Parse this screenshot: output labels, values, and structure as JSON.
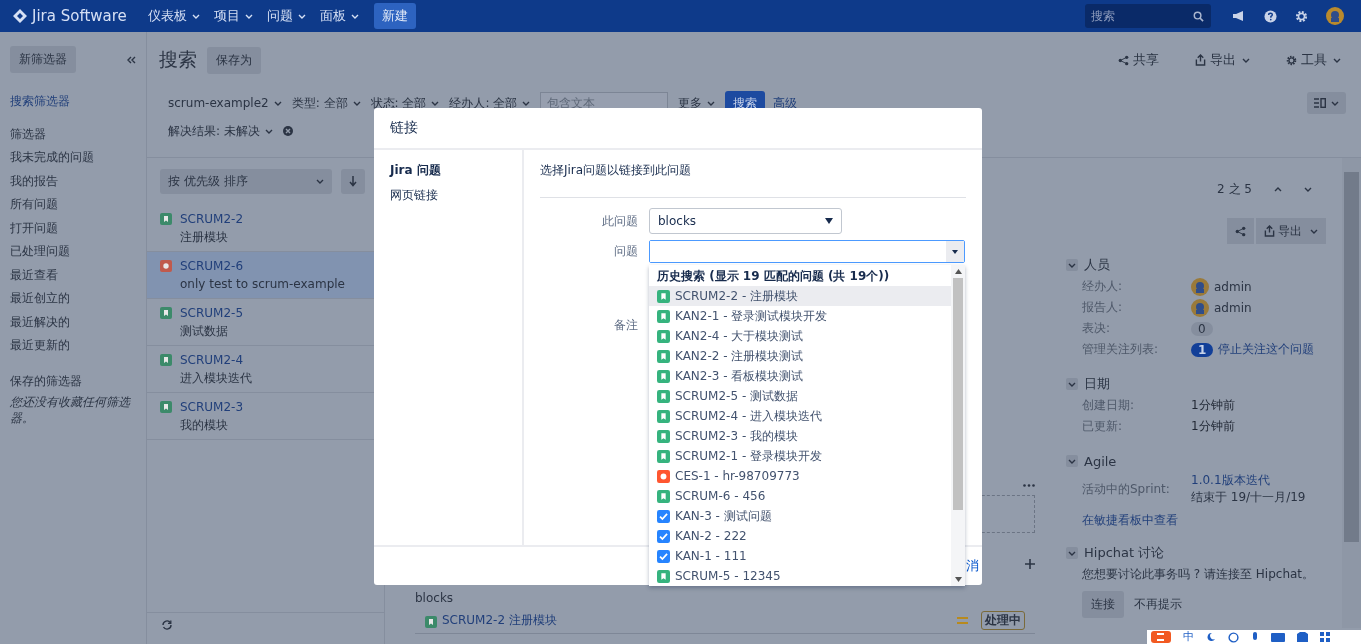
{
  "topbar": {
    "logo": "Jira Software",
    "menus": [
      {
        "label": "仪表板"
      },
      {
        "label": "项目"
      },
      {
        "label": "问题"
      },
      {
        "label": "面板"
      }
    ],
    "create_button": "新建",
    "search": {
      "placeholder": "搜索"
    }
  },
  "sidebar": {
    "new_filter_button": "新筛选器",
    "search_filters_link": "搜索筛选器",
    "filters_heading": "筛选器",
    "items": [
      "我未完成的问题",
      "我的报告",
      "所有问题",
      "打开问题",
      "已处理问题",
      "最近查看",
      "最近创立的",
      "最近解决的",
      "最近更新的"
    ],
    "saved_heading": "保存的筛选器",
    "saved_note": "您还没有收藏任何筛选器。"
  },
  "header": {
    "title": "搜索",
    "save_as_button": "保存为",
    "actions": [
      {
        "kind": "share",
        "label": "共享",
        "menu": false
      },
      {
        "kind": "export",
        "label": "导出",
        "menu": true
      },
      {
        "kind": "tools",
        "label": "工具",
        "menu": true
      }
    ]
  },
  "filters": {
    "items": [
      "scrum-example2",
      "类型: 全部",
      "状态: 全部",
      "经办人: 全部"
    ],
    "text_search": {
      "placeholder": "包含文本"
    },
    "more": "更多",
    "search_button": "搜索",
    "advanced_link": "高级",
    "resolution": "解决结果: 未解决"
  },
  "issue_list": {
    "sort": "按 优先级 排序",
    "items": [
      {
        "key": "SCRUM2-2",
        "summary": "注册模块",
        "kind": "story",
        "selected": false
      },
      {
        "key": "SCRUM2-6",
        "summary": "only test to scrum-example",
        "kind": "bug",
        "selected": true
      },
      {
        "key": "SCRUM2-5",
        "summary": "测试数据",
        "kind": "story",
        "selected": false
      },
      {
        "key": "SCRUM2-4",
        "summary": "进入模块迭代",
        "kind": "story",
        "selected": false
      },
      {
        "key": "SCRUM2-3",
        "summary": "我的模块",
        "kind": "story",
        "selected": false
      }
    ]
  },
  "detail": {
    "pager": "2 之 5",
    "export_button": "导出",
    "link_group": {
      "label": "blocks",
      "issue": "SCRUM2-2 注册模块",
      "kind": "story",
      "status": "处理中"
    },
    "sections": [
      {
        "title": "人员",
        "expanded": true,
        "rows": [
          {
            "kind": "user",
            "label": "经办人:",
            "value": "admin"
          },
          {
            "kind": "user",
            "label": "报告人:",
            "value": "admin"
          },
          {
            "kind": "count",
            "label": "表决:",
            "value": "0"
          },
          {
            "kind": "watch",
            "label": "管理关注列表:",
            "value": "1",
            "link": "停止关注这个问题"
          }
        ]
      },
      {
        "title": "日期",
        "expanded": true,
        "rows": [
          {
            "kind": "text",
            "label": "创建日期:",
            "value": "1分钟前"
          },
          {
            "kind": "text",
            "label": "已更新:",
            "value": "1分钟前"
          }
        ]
      },
      {
        "title": "Agile",
        "expanded": true,
        "rows": [
          {
            "kind": "sprint",
            "label": "活动中的Sprint:",
            "value": "1.0.1版本迭代",
            "note": "结束于 19/十一月/19"
          }
        ],
        "link": "在敏捷看板中查看"
      },
      {
        "title": "Hipchat 讨论",
        "expanded": true,
        "text": "您想要讨论此事务吗 ? 请连接至 Hipchat。",
        "buttons": [
          "连接",
          "不再提示"
        ]
      }
    ]
  },
  "modal": {
    "title": "链接",
    "nav": [
      {
        "label": "Jira 问题",
        "selected": true
      },
      {
        "label": "网页链接",
        "selected": false
      }
    ],
    "description": "选择Jira问题以链接到此问题",
    "link_type": {
      "label": "此问题",
      "value": "blocks"
    },
    "issue": {
      "label": "问题"
    },
    "comment": {
      "label": "备注"
    },
    "cancel": "消",
    "dropdown": {
      "heading": "历史搜索 (显示 19 匹配的问题 (共 19个))",
      "items": [
        {
          "text": "SCRUM2-2 - 注册模块",
          "kind": "story",
          "selected": true
        },
        {
          "text": "KAN2-1 - 登录测试模块开发",
          "kind": "story",
          "selected": false
        },
        {
          "text": "KAN2-4 - 大于模块测试",
          "kind": "story",
          "selected": false
        },
        {
          "text": "KAN2-2 - 注册模块测试",
          "kind": "story",
          "selected": false
        },
        {
          "text": "KAN2-3 - 看板模块测试",
          "kind": "story",
          "selected": false
        },
        {
          "text": "SCRUM2-5 - 测试数据",
          "kind": "story",
          "selected": false
        },
        {
          "text": "SCRUM2-4 - 进入模块迭代",
          "kind": "story",
          "selected": false
        },
        {
          "text": "SCRUM2-3 - 我的模块",
          "kind": "story",
          "selected": false
        },
        {
          "text": "SCRUM2-1 - 登录模块开发",
          "kind": "story",
          "selected": false
        },
        {
          "text": "CES-1 - hr-98709773",
          "kind": "bug",
          "selected": false
        },
        {
          "text": "SCRUM-6 - 456",
          "kind": "story",
          "selected": false
        },
        {
          "text": "KAN-3 - 测试问题",
          "kind": "task",
          "selected": false
        },
        {
          "text": "KAN-2 - 222",
          "kind": "task",
          "selected": false
        },
        {
          "text": "KAN-1 - 111",
          "kind": "task",
          "selected": false
        },
        {
          "text": "SCRUM-5 - 12345",
          "kind": "story",
          "selected": false
        }
      ]
    }
  },
  "ime_bar": {
    "label": "中"
  }
}
